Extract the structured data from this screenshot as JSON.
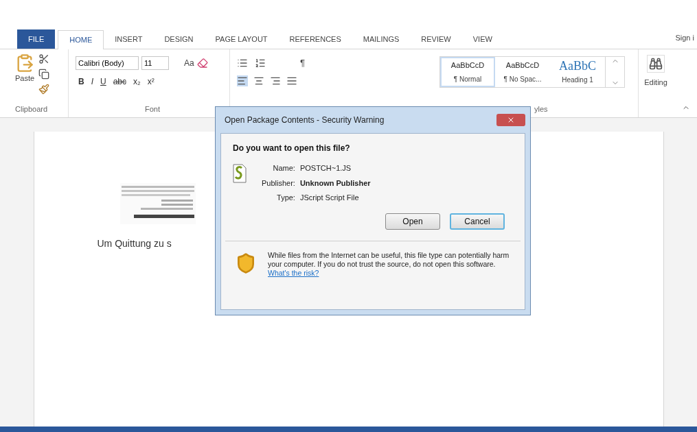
{
  "ribbon_tabs": [
    {
      "label": "FILE",
      "kind": "file",
      "selected": false
    },
    {
      "label": "HOME",
      "kind": "tab",
      "selected": true
    },
    {
      "label": "INSERT",
      "kind": "tab",
      "selected": false
    },
    {
      "label": "DESIGN",
      "kind": "tab",
      "selected": false
    },
    {
      "label": "PAGE LAYOUT",
      "kind": "tab",
      "selected": false
    },
    {
      "label": "REFERENCES",
      "kind": "tab",
      "selected": false
    },
    {
      "label": "MAILINGS",
      "kind": "tab",
      "selected": false
    },
    {
      "label": "REVIEW",
      "kind": "tab",
      "selected": false
    },
    {
      "label": "VIEW",
      "kind": "tab",
      "selected": false
    }
  ],
  "account": {
    "label": "Sign i"
  },
  "clipboard": {
    "paste_label": "Paste",
    "group_label": "Clipboard"
  },
  "font": {
    "font_name": "Calibri (Body)",
    "font_size": "11",
    "case_button": "Aa",
    "group_label": "Font",
    "format_buttons": [
      {
        "label": "B",
        "kind": "bold"
      },
      {
        "label": "I",
        "kind": "italic"
      },
      {
        "label": "U",
        "kind": "underline"
      },
      {
        "label": "abc",
        "kind": "strike"
      },
      {
        "label": "x₂",
        "kind": "plain"
      },
      {
        "label": "x²",
        "kind": "plain"
      }
    ]
  },
  "paragraph": {
    "pilcrow": "¶"
  },
  "styles": {
    "group_label": "yles",
    "items": [
      {
        "preview": "AaBbCcD",
        "label": "¶ Normal",
        "kind": "body",
        "selected": true
      },
      {
        "preview": "AaBbCcD",
        "label": "¶ No Spac...",
        "kind": "body",
        "selected": false
      },
      {
        "preview": "AaBbC",
        "label": "Heading 1",
        "kind": "heading",
        "selected": false
      }
    ]
  },
  "editing": {
    "label": "Editing"
  },
  "document": {
    "caption": "Um Quittung zu s"
  },
  "dialog": {
    "title": "Open Package Contents - Security Warning",
    "question": "Do you want to open this file?",
    "fields": [
      {
        "label": "Name:",
        "value": "POSTCH~1.JS",
        "bold": false
      },
      {
        "label": "Publisher:",
        "value": "Unknown Publisher",
        "bold": true
      },
      {
        "label": "Type:",
        "value": "JScript Script File",
        "bold": false
      }
    ],
    "buttons": [
      {
        "label": "Open",
        "selected": false
      },
      {
        "label": "Cancel",
        "selected": true
      }
    ],
    "warning": "While files from the Internet can be useful, this file type can potentially harm your computer. If you do not trust the source, do not open this software.",
    "risk_link": "What's the risk?"
  }
}
